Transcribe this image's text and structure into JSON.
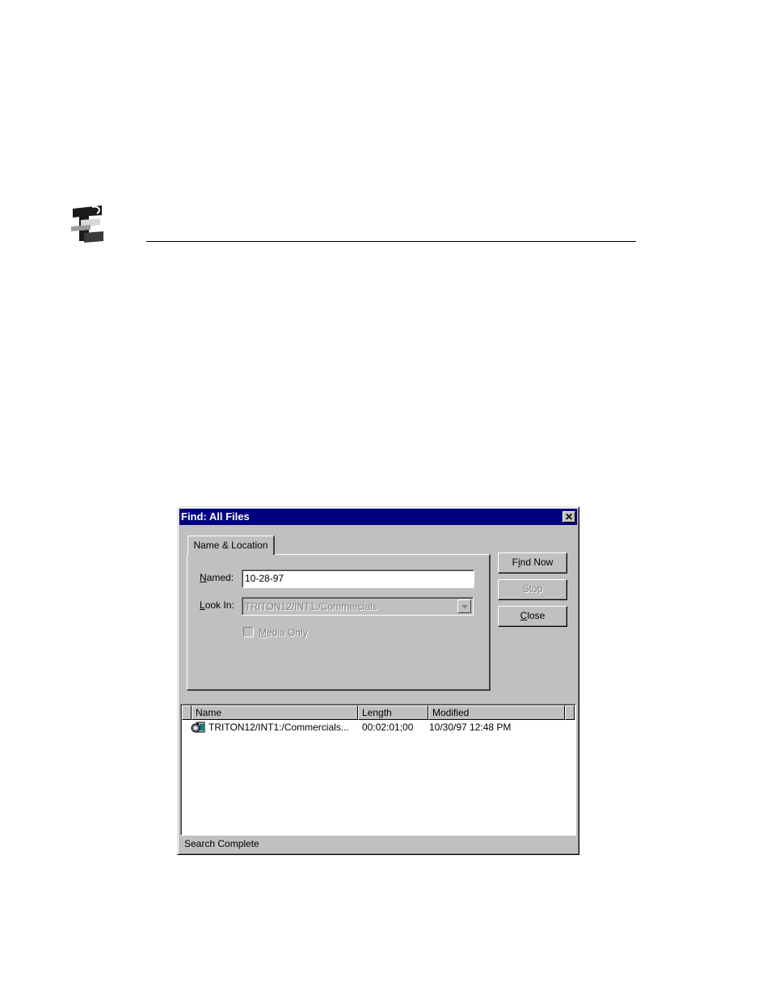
{
  "dialog": {
    "title": "Find: All Files",
    "close_glyph": "✕",
    "tab_label": "Name & Location",
    "named_label_key": "N",
    "named_label_rest": "amed:",
    "named_value": "10-28-97",
    "lookin_label_key": "L",
    "lookin_label_rest": "ook In:",
    "lookin_value": "TRITON12/INT1:/Commercials",
    "media_only_key": "M",
    "media_only_rest": "edia Only",
    "find_now_pre": "F",
    "find_now_key": "i",
    "find_now_post": "nd Now",
    "stop_label": "Stop",
    "close_key": "C",
    "close_rest": "lose",
    "columns": [
      "Name",
      "Length",
      "Modified"
    ],
    "rows": [
      {
        "name": "TRITON12/INT1:/Commercials...",
        "length": "00:02:01;00",
        "modified": "10/30/97 12:48 PM",
        "icon": "clip-file-icon"
      }
    ],
    "status": "Search Complete"
  },
  "colors": {
    "titlebar": "#000080",
    "face": "#c0c0c0"
  }
}
